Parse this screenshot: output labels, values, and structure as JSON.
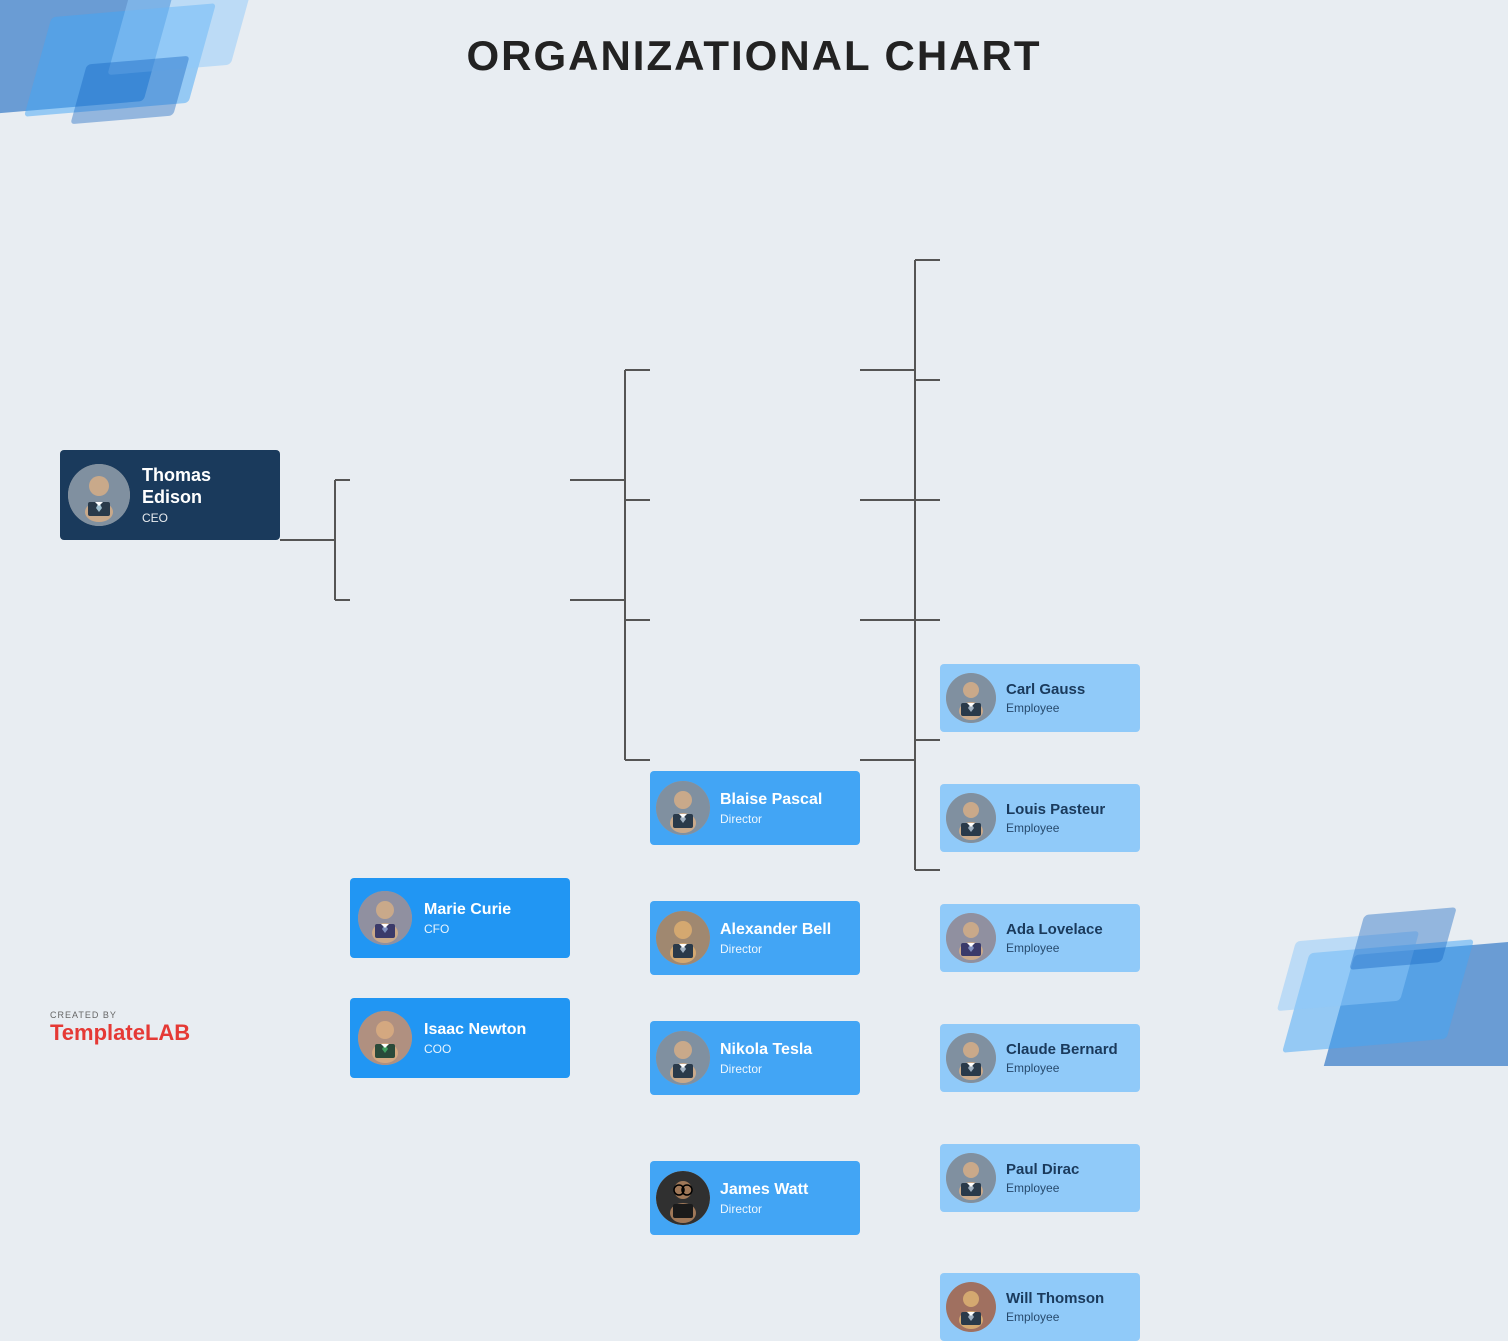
{
  "title": "ORGANIZATIONAL CHART",
  "ceo": {
    "name": "Thomas Edison",
    "role": "CEO",
    "avatar_color": "#8090a0"
  },
  "managers": [
    {
      "name": "Marie Curie",
      "role": "CFO",
      "avatar_color": "#9090a0"
    },
    {
      "name": "Isaac Newton",
      "role": "COO",
      "avatar_color": "#b09080"
    }
  ],
  "directors": [
    {
      "name": "Blaise Pascal",
      "role": "Director",
      "avatar_color": "#8090a0"
    },
    {
      "name": "Alexander Bell",
      "role": "Director",
      "avatar_color": "#a08870"
    },
    {
      "name": "Nikola Tesla",
      "role": "Director",
      "avatar_color": "#8090a0"
    },
    {
      "name": "James Watt",
      "role": "Director",
      "avatar_color": "#303030"
    }
  ],
  "employees": [
    {
      "name": "Carl Gauss",
      "role": "Employee",
      "avatar_color": "#8090a0"
    },
    {
      "name": "Louis Pasteur",
      "role": "Employee",
      "avatar_color": "#8090a0"
    },
    {
      "name": "Ada Lovelace",
      "role": "Employee",
      "avatar_color": "#9090a0"
    },
    {
      "name": "Claude Bernard",
      "role": "Employee",
      "avatar_color": "#8090a0"
    },
    {
      "name": "Paul Dirac",
      "role": "Employee",
      "avatar_color": "#8090a0"
    },
    {
      "name": "Will Thomson",
      "role": "Employee",
      "avatar_color": "#a07060"
    }
  ],
  "brand": {
    "created_by": "CREATED BY",
    "template": "Template",
    "lab": "LAB"
  },
  "colors": {
    "ceo_bg": "#1a3a5c",
    "manager_bg": "#2196F3",
    "director_bg": "#42a5f5",
    "employee_bg": "#90caf9",
    "accent_blue": "#1565C0"
  }
}
